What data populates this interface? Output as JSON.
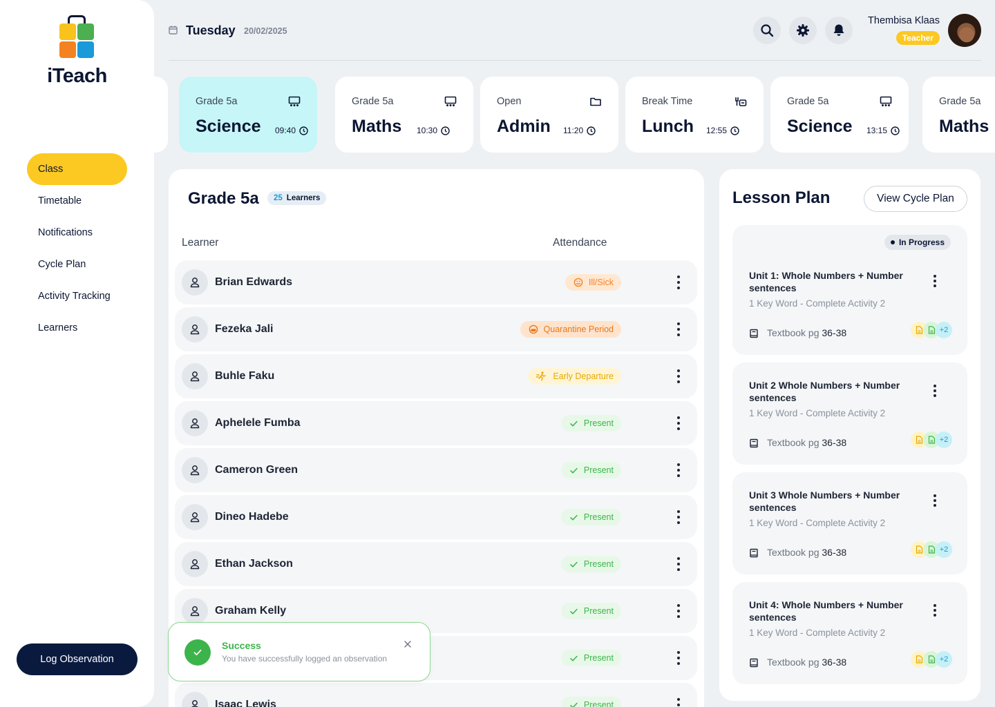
{
  "app": {
    "brand": "iTeach"
  },
  "sidebar": {
    "items": [
      {
        "label": "Class",
        "active": true
      },
      {
        "label": "Timetable"
      },
      {
        "label": "Notifications"
      },
      {
        "label": "Cycle Plan"
      },
      {
        "label": "Activity Tracking"
      },
      {
        "label": "Learners"
      }
    ],
    "log_button": "Log Observation"
  },
  "header": {
    "day": "Tuesday",
    "date": "20/02/2025",
    "user_name": "Thembisa Klaas",
    "user_role": "Teacher"
  },
  "schedule": [
    {
      "sub": "Grade 5a",
      "title": "Science",
      "time": "09:40",
      "icon": "classroom-icon",
      "active": true
    },
    {
      "sub": "Grade 5a",
      "title": "Maths",
      "time": "10:30",
      "icon": "classroom-icon"
    },
    {
      "sub": "Open",
      "title": "Admin",
      "time": "11:20",
      "icon": "folder-icon"
    },
    {
      "sub": "Break Time",
      "title": "Lunch",
      "time": "12:55",
      "icon": "lunch-icon"
    },
    {
      "sub": "Grade 5a",
      "title": "Science",
      "time": "13:15",
      "icon": "classroom-icon"
    },
    {
      "sub": "Grade 5a",
      "title": "Maths",
      "time": "",
      "icon": "classroom-icon"
    }
  ],
  "class_panel": {
    "title": "Grade 5a",
    "learner_count": "25",
    "learner_label": "Learners",
    "col_learner": "Learner",
    "col_attendance": "Attendance",
    "learners": [
      {
        "name": "Brian Edwards",
        "status": "Ill/Sick",
        "kind": "sick"
      },
      {
        "name": "Fezeka Jali",
        "status": "Quarantine Period",
        "kind": "quarantine"
      },
      {
        "name": "Buhle Faku",
        "status": "Early Departure",
        "kind": "early"
      },
      {
        "name": "Aphelele Fumba",
        "status": "Present",
        "kind": "present"
      },
      {
        "name": "Cameron Green",
        "status": "Present",
        "kind": "present"
      },
      {
        "name": "Dineo Hadebe",
        "status": "Present",
        "kind": "present"
      },
      {
        "name": "Ethan Jackson",
        "status": "Present",
        "kind": "present"
      },
      {
        "name": "Graham Kelly",
        "status": "Present",
        "kind": "present"
      },
      {
        "name": "",
        "status": "Present",
        "kind": "present"
      },
      {
        "name": "Isaac Lewis",
        "status": "Present",
        "kind": "present"
      }
    ]
  },
  "toast": {
    "title": "Success",
    "message": "You have successfully logged an observation"
  },
  "lesson_panel": {
    "title": "Lesson Plan",
    "view_button": "View Cycle Plan",
    "units": [
      {
        "title": "Unit 1: Whole Numbers + Number sentences",
        "subtitle": "1 Key Word - Complete Activity 2",
        "textbook": "Textbook pg",
        "pages": "36-38",
        "extra": "+2",
        "status": "In Progress"
      },
      {
        "title": "Unit 2 Whole Numbers + Number sentences",
        "subtitle": "1 Key Word - Complete Activity 2",
        "textbook": "Textbook pg",
        "pages": "36-38",
        "extra": "+2"
      },
      {
        "title": "Unit 3 Whole Numbers + Number sentences",
        "subtitle": "1 Key Word - Complete Activity 2",
        "textbook": "Textbook pg",
        "pages": "36-38",
        "extra": "+2"
      },
      {
        "title": "Unit 4: Whole Numbers + Number sentences",
        "subtitle": "1 Key Word - Complete Activity 2",
        "textbook": "Textbook pg",
        "pages": "36-38",
        "extra": "+2"
      }
    ]
  },
  "colors": {
    "accent": "#fcc822",
    "navy": "#0a1a3f",
    "active_card": "#c6f6f7",
    "present_bg": "#e8f8e8",
    "present_fg": "#3cb44b",
    "sick_bg": "#ffe8d2",
    "sick_fg": "#f58220",
    "quarantine_bg": "#ffe3cc",
    "quarantine_fg": "#e8771a",
    "early_bg": "#fff5d6",
    "early_fg": "#e6a800"
  }
}
